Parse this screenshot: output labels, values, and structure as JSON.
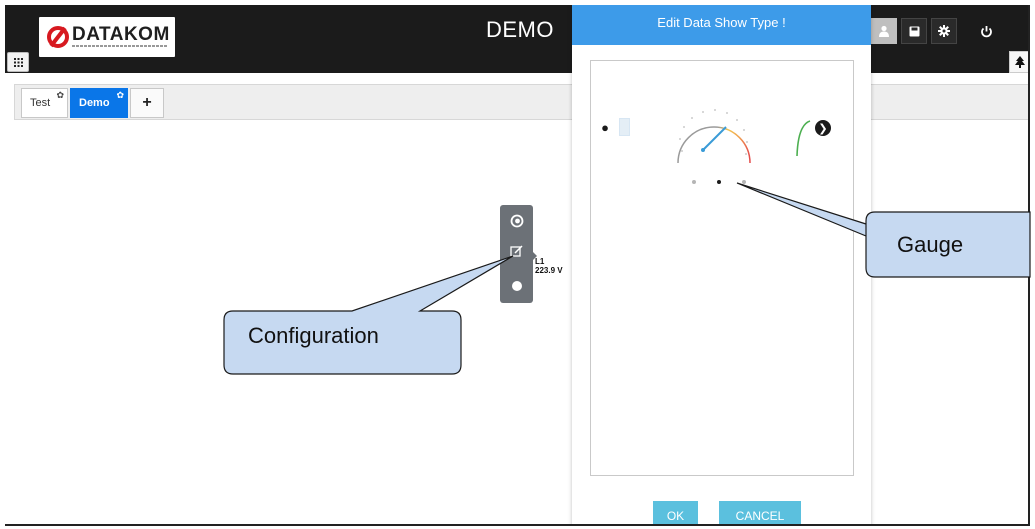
{
  "header": {
    "logo_text": "DATAKOM",
    "title": "DEMO",
    "buttons": [
      {
        "name": "user-icon",
        "glyph": "👤"
      },
      {
        "name": "save-icon",
        "glyph": "▪"
      },
      {
        "name": "gear-icon",
        "glyph": "✿"
      },
      {
        "name": "power-icon",
        "glyph": "⏻"
      }
    ],
    "apps_icon": "grid-icon",
    "tree_icon": "tree-icon"
  },
  "tabs": [
    {
      "label": "Test",
      "active": false
    },
    {
      "label": "Demo",
      "active": true
    }
  ],
  "add_tab_label": "+",
  "widget": {
    "label_line1": "L1",
    "label_line2": "223.9 V",
    "toolbar_icons": [
      "gauge-type-icon",
      "edit-icon",
      "toggle-icon"
    ]
  },
  "modal": {
    "title": "Edit Data Show Type !",
    "ok_label": "OK",
    "cancel_label": "CANCEL",
    "carousel_index": 1,
    "carousel_count": 3
  },
  "callouts": {
    "configuration": "Configuration",
    "gauge": "Gauge"
  },
  "colors": {
    "header_bg": "#1b1b1b",
    "active_tab": "#0a76e8",
    "modal_header": "#3d9be9",
    "modal_button": "#5bc0de",
    "callout_fill": "#c6d9f1",
    "callout_stroke": "#1a1a1a"
  }
}
